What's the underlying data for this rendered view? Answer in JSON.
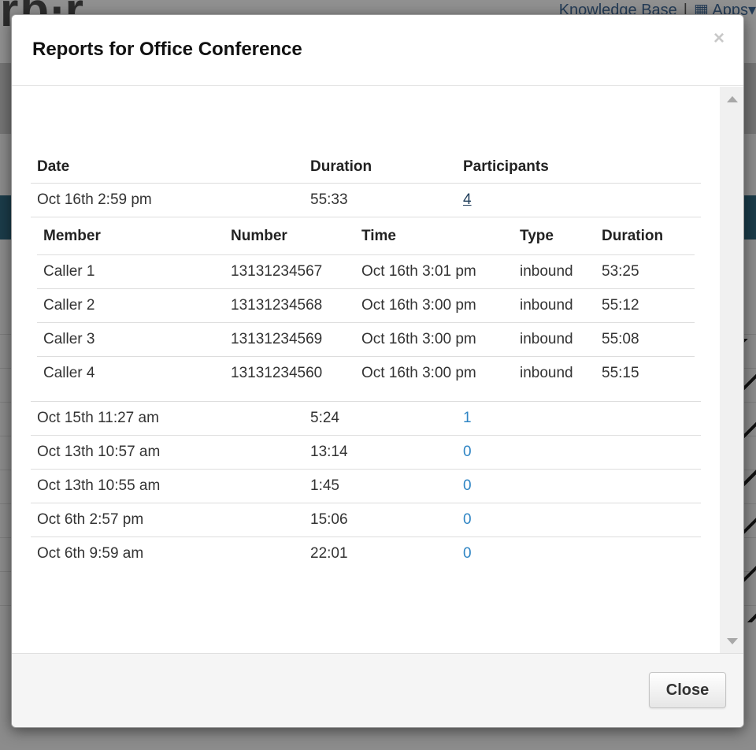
{
  "background": {
    "logo_text": "rb∙r",
    "links": [
      "Knowledge Base",
      "Apps"
    ]
  },
  "modal": {
    "title": "Reports for Office Conference",
    "close_x": "×",
    "close_button": "Close"
  },
  "reports": {
    "headers": {
      "date": "Date",
      "duration": "Duration",
      "participants": "Participants"
    },
    "rows": [
      {
        "date": "Oct 16th 2:59 pm",
        "duration": "55:33",
        "participants": "4"
      },
      {
        "date": "Oct 15th 11:27 am",
        "duration": "5:24",
        "participants": "1"
      },
      {
        "date": "Oct 13th 10:57 am",
        "duration": "13:14",
        "participants": "0"
      },
      {
        "date": "Oct 13th 10:55 am",
        "duration": "1:45",
        "participants": "0"
      },
      {
        "date": "Oct 6th 2:57 pm",
        "duration": "15:06",
        "participants": "0"
      },
      {
        "date": "Oct 6th 9:59 am",
        "duration": "22:01",
        "participants": "0"
      }
    ],
    "participants_detail": {
      "headers": {
        "member": "Member",
        "number": "Number",
        "time": "Time",
        "type": "Type",
        "duration": "Duration"
      },
      "rows": [
        {
          "member": "Caller 1",
          "number": "13131234567",
          "time": "Oct 16th 3:01 pm",
          "type": "inbound",
          "duration": "53:25"
        },
        {
          "member": "Caller 2",
          "number": "13131234568",
          "time": "Oct 16th 3:00 pm",
          "type": "inbound",
          "duration": "55:12"
        },
        {
          "member": "Caller 3",
          "number": "13131234569",
          "time": "Oct 16th 3:00 pm",
          "type": "inbound",
          "duration": "55:08"
        },
        {
          "member": "Caller 4",
          "number": "13131234560",
          "time": "Oct 16th 3:00 pm",
          "type": "inbound",
          "duration": "55:15"
        }
      ]
    }
  }
}
